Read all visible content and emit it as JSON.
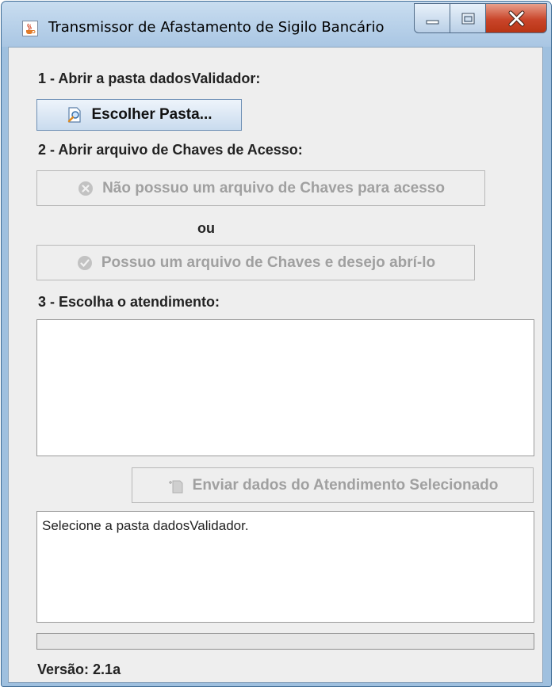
{
  "window": {
    "title": "Transmissor de Afastamento de Sigilo Bancário",
    "icon": "java-cup-icon",
    "controls": [
      "minimize-icon",
      "maximize-icon",
      "close-icon"
    ]
  },
  "step1": {
    "label": "1 - Abrir a pasta dadosValidador:",
    "button_label": "Escolher Pasta...",
    "button_icon": "folder-search-icon"
  },
  "step2": {
    "label": "2 - Abrir arquivo de Chaves de Acesso:",
    "no_keys_button": "Não possuo um arquivo de Chaves para acesso",
    "no_keys_icon": "cancel-circle-icon",
    "separator": "ou",
    "have_keys_button": "Possuo um arquivo de Chaves e desejo abrí-lo",
    "have_keys_icon": "check-circle-icon"
  },
  "step3": {
    "label": "3 - Escolha o atendimento:",
    "list_items": [],
    "send_button": "Enviar dados do Atendimento Selecionado",
    "send_icon": "document-send-icon"
  },
  "log": {
    "text": "Selecione a pasta dadosValidador."
  },
  "progress": {
    "value": 0
  },
  "footer": {
    "version": "Versão: 2.1a"
  },
  "colors": {
    "window_frame": "#9fc0df",
    "content_bg": "#eeeeee",
    "close_button": "#c9452a",
    "disabled_text": "#a0a0a0"
  }
}
